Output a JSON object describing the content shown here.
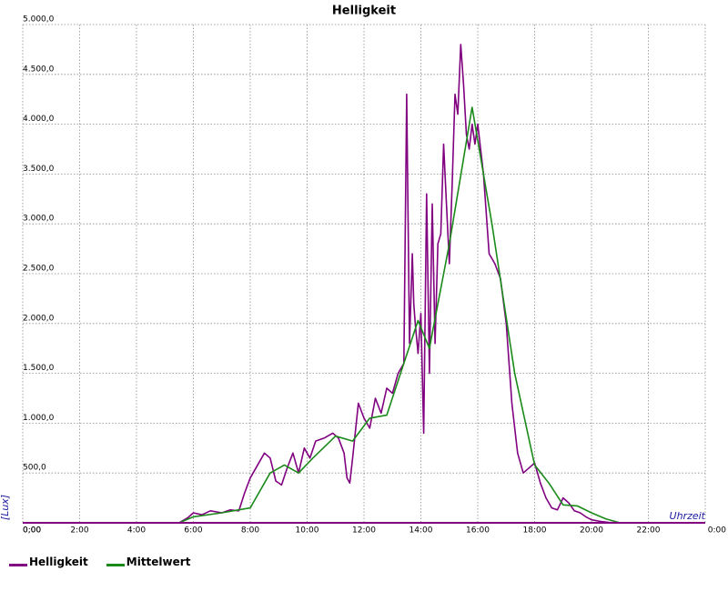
{
  "chart_data": {
    "type": "line",
    "title": "Helligkeit",
    "xlabel": "Uhrzeit",
    "ylabel": "[Lux]",
    "xlim": [
      0,
      24
    ],
    "ylim": [
      0,
      5000
    ],
    "grid": true,
    "legend": "bottom-left",
    "x_ticks": [
      "0:00",
      "2:00",
      "4:00",
      "6:00",
      "8:00",
      "10:00",
      "12:00",
      "14:00",
      "16:00",
      "18:00",
      "20:00",
      "22:00",
      "0:00"
    ],
    "y_ticks": [
      "0,00",
      "500,0",
      "1.000,0",
      "1.500,0",
      "2.000,0",
      "2.500,0",
      "3.000,0",
      "3.500,0",
      "4.000,0",
      "4.500,0",
      "5.000,0"
    ],
    "series": [
      {
        "name": "Helligkeit",
        "color": "#800080",
        "x": [
          0,
          5.5,
          5.8,
          6.0,
          6.3,
          6.6,
          7.0,
          7.3,
          7.6,
          7.8,
          8.0,
          8.3,
          8.5,
          8.7,
          8.9,
          9.1,
          9.3,
          9.5,
          9.7,
          9.9,
          10.1,
          10.3,
          10.6,
          10.9,
          11.1,
          11.3,
          11.4,
          11.5,
          11.6,
          11.8,
          12.0,
          12.2,
          12.4,
          12.6,
          12.8,
          13.0,
          13.2,
          13.4,
          13.5,
          13.6,
          13.7,
          13.75,
          13.8,
          13.9,
          14.0,
          14.1,
          14.2,
          14.3,
          14.4,
          14.5,
          14.6,
          14.7,
          14.8,
          14.9,
          15.0,
          15.1,
          15.2,
          15.3,
          15.4,
          15.5,
          15.6,
          15.7,
          15.8,
          15.9,
          16.0,
          16.2,
          16.4,
          16.6,
          16.8,
          17.0,
          17.2,
          17.4,
          17.6,
          17.8,
          18.0,
          18.2,
          18.4,
          18.6,
          18.8,
          19.0,
          19.2,
          19.4,
          19.6,
          19.8,
          20.0,
          20.3,
          20.6,
          21.0,
          24
        ],
        "y": [
          0,
          0,
          50,
          100,
          80,
          120,
          100,
          130,
          120,
          300,
          450,
          600,
          700,
          650,
          420,
          380,
          550,
          700,
          500,
          750,
          650,
          820,
          850,
          900,
          850,
          700,
          450,
          400,
          650,
          1200,
          1050,
          950,
          1250,
          1100,
          1350,
          1300,
          1500,
          1600,
          4300,
          1800,
          2700,
          2200,
          2000,
          1700,
          2100,
          900,
          3300,
          1500,
          3200,
          1800,
          2800,
          2900,
          3800,
          3200,
          2600,
          3400,
          4300,
          4100,
          4800,
          4400,
          3900,
          3750,
          4000,
          3800,
          4000,
          3500,
          2700,
          2600,
          2450,
          2000,
          1200,
          700,
          500,
          550,
          600,
          400,
          250,
          150,
          130,
          250,
          200,
          120,
          100,
          60,
          30,
          15,
          5,
          0,
          0
        ]
      },
      {
        "name": "Mittelwert",
        "color": "#1a8a1a",
        "x": [
          0,
          5.5,
          6.0,
          7.0,
          8.0,
          8.7,
          9.2,
          9.7,
          10.2,
          11.0,
          11.6,
          12.2,
          12.8,
          13.4,
          13.9,
          14.3,
          14.5,
          15.0,
          15.8,
          16.5,
          17.3,
          18.0,
          18.5,
          19.0,
          19.5,
          20.0,
          20.5,
          21.0,
          24
        ],
        "y": [
          0,
          0,
          60,
          100,
          150,
          500,
          580,
          500,
          650,
          870,
          820,
          1050,
          1080,
          1600,
          2030,
          1750,
          2050,
          2800,
          4170,
          3000,
          1500,
          580,
          400,
          180,
          170,
          100,
          40,
          0,
          0
        ]
      }
    ]
  }
}
